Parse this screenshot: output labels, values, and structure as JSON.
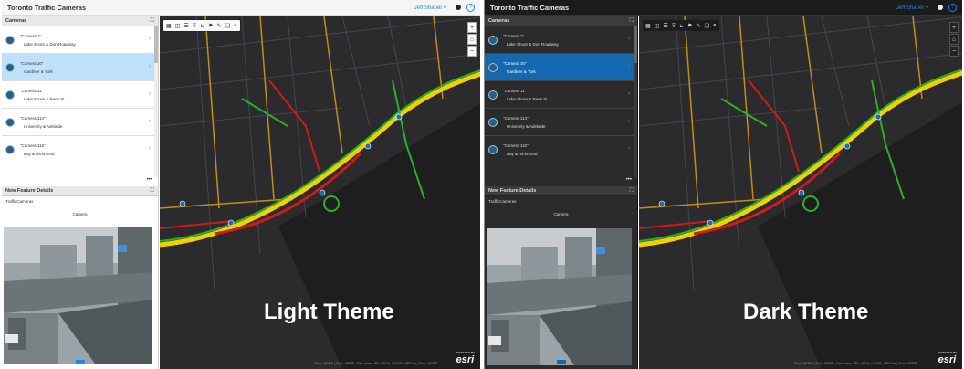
{
  "apps": [
    {
      "theme": "light",
      "title": "Toronto Traffic Cameras",
      "user": "Jeff Shaner ▾",
      "help_glyph": "?",
      "cameras_header": "Cameras",
      "cameras": [
        {
          "name": "\"Camera 1\"",
          "location": "Lake Shore & Don Roadway"
        },
        {
          "name": "\"Camera 10\"",
          "location": "Gardiner & York",
          "selected": true
        },
        {
          "name": "\"Camera 11\"",
          "location": "Lake Shore & Rees St."
        },
        {
          "name": "\"Camera 114\"",
          "location": "University & Adelaide"
        },
        {
          "name": "\"Camera 115\"",
          "location": "Bay & Richmond"
        }
      ],
      "more_glyph": "•••",
      "details_header": "New Feature Details",
      "layer_name": "TrafficCameras",
      "field_label": "Camera",
      "map_label": "Light Theme",
      "attribution": "Esri, HERE | Esri, HERE, DeLorme, IPC, NGA, USGS, NRCan | Esri, HERE",
      "esri_small": "POWERED BY",
      "esri": "esri"
    },
    {
      "theme": "dark",
      "title": "Toronto Traffic Cameras",
      "user": "Jeff Shaner ▾",
      "help_glyph": "?",
      "cameras_header": "Cameras",
      "cameras": [
        {
          "name": "\"Camera 1\"",
          "location": "Lake Shore & Don Roadway"
        },
        {
          "name": "\"Camera 10\"",
          "location": "Gardiner & York",
          "selected": true
        },
        {
          "name": "\"Camera 11\"",
          "location": "Lake Shore & Rees St."
        },
        {
          "name": "\"Camera 114\"",
          "location": "University & Adelaide"
        },
        {
          "name": "\"Camera 115\"",
          "location": "Bay & Richmond"
        }
      ],
      "more_glyph": "•••",
      "details_header": "New Feature Details",
      "layer_name": "TrafficCameras",
      "field_label": "Camera",
      "map_label": "Dark Theme",
      "attribution": "Esri, HERE | Esri, HERE, DeLorme, IPC, NGA, USGS, NRCan | Esri, HERE",
      "esri_small": "POWERED BY",
      "esri": "esri"
    }
  ],
  "toolbar_icons": [
    "layers-icon",
    "basemap-icon",
    "legend-icon",
    "filter-icon",
    "measure-icon",
    "bookmark-icon",
    "draw-icon",
    "edit-icon",
    "locate-icon"
  ],
  "zoom": {
    "plus": "+",
    "home": "⌂",
    "minus": "−"
  },
  "colors": {
    "accent": "#1e88e5",
    "selected_light": "#bfe1fb",
    "selected_dark": "#1368b0",
    "map_bg": "#2b2b2e",
    "traffic_red": "#d11a1a",
    "traffic_yellow": "#f0d000",
    "traffic_green": "#29b02a"
  }
}
